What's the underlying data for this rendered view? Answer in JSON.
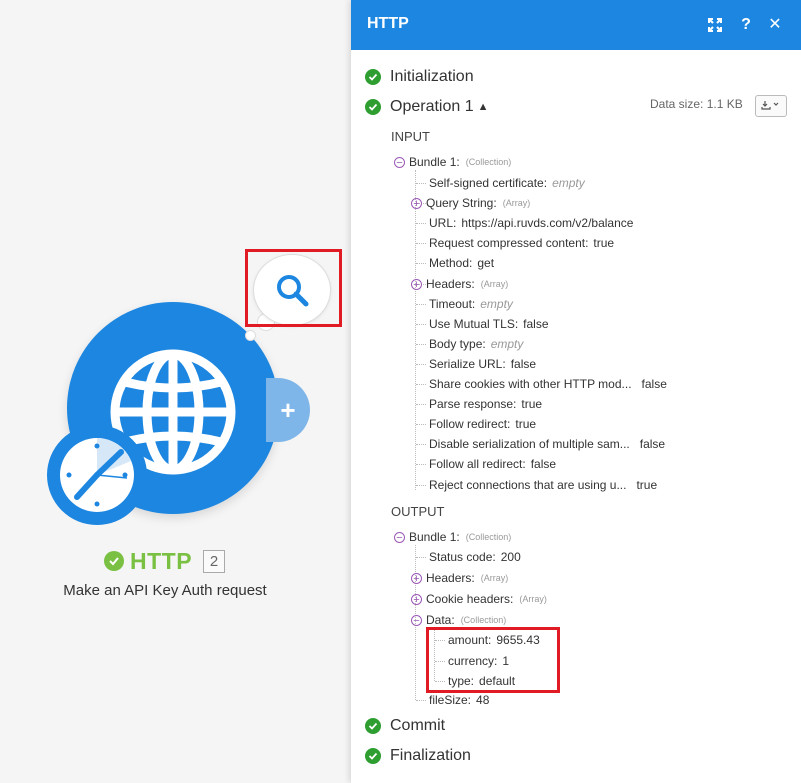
{
  "module": {
    "name": "HTTP",
    "number": "2",
    "description": "Make an API Key Auth request"
  },
  "panel": {
    "title": "HTTP",
    "expand_icon": "expand-icon",
    "help_label": "?",
    "close_label": "✕",
    "stages": {
      "initialization": "Initialization",
      "operation": "Operation 1",
      "commit": "Commit",
      "finalization": "Finalization"
    },
    "data_size": "Data size: 1.1 KB",
    "download_icon": "download-icon"
  },
  "input": {
    "label": "INPUT",
    "bundle": {
      "key": "Bundle 1:",
      "type": "(Collection)"
    },
    "rows": [
      {
        "key": "Self-signed certificate:",
        "value": "empty",
        "empty": true
      },
      {
        "key": "Query String:",
        "type": "(Array)",
        "toggle": "+"
      },
      {
        "key": "URL:",
        "value": "https://api.ruvds.com/v2/balance"
      },
      {
        "key": "Request compressed content:",
        "value": "true"
      },
      {
        "key": "Method:",
        "value": "get"
      },
      {
        "key": "Headers:",
        "type": "(Array)",
        "toggle": "+"
      },
      {
        "key": "Timeout:",
        "value": "empty",
        "empty": true
      },
      {
        "key": "Use Mutual TLS:",
        "value": "false"
      },
      {
        "key": "Body type:",
        "value": "empty",
        "empty": true
      },
      {
        "key": "Serialize URL:",
        "value": "false"
      },
      {
        "key": "Share cookies with other HTTP mod...",
        "value": "false",
        "gap": true
      },
      {
        "key": "Parse response:",
        "value": "true"
      },
      {
        "key": "Follow redirect:",
        "value": "true"
      },
      {
        "key": "Disable serialization of multiple sam...",
        "value": "false",
        "gap": true
      },
      {
        "key": "Follow all redirect:",
        "value": "false"
      },
      {
        "key": "Reject connections that are using u...",
        "value": "true",
        "gap": true
      }
    ]
  },
  "output": {
    "label": "OUTPUT",
    "bundle": {
      "key": "Bundle 1:",
      "type": "(Collection)"
    },
    "status": {
      "key": "Status code:",
      "value": "200"
    },
    "headers": {
      "key": "Headers:",
      "type": "(Array)"
    },
    "cookies": {
      "key": "Cookie headers:",
      "type": "(Array)"
    },
    "data": {
      "key": "Data:",
      "type": "(Collection)"
    },
    "data_rows": [
      {
        "key": "amount:",
        "value": "9655.43"
      },
      {
        "key": "currency:",
        "value": "1"
      },
      {
        "key": "type:",
        "value": "default"
      }
    ],
    "filesize": {
      "key": "fileSize:",
      "value": "48"
    }
  },
  "colors": {
    "brand_blue": "#1c86e0",
    "success_green": "#2e9e31",
    "title_green": "#7ac143",
    "highlight_red": "#e01b24"
  }
}
